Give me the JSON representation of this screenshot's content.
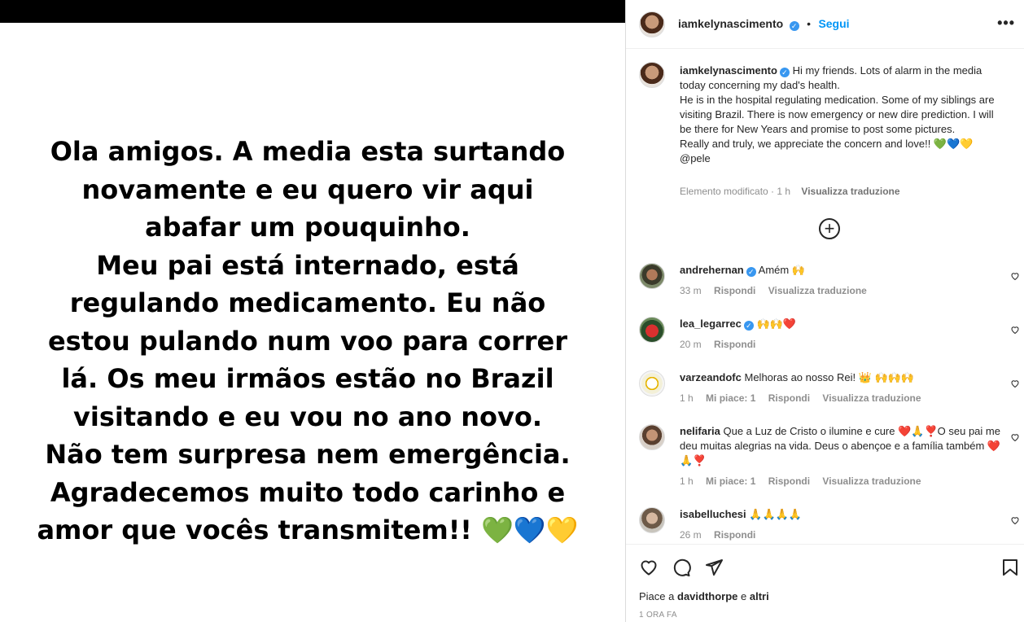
{
  "story": {
    "text": "Ola amigos. A media esta surtando\nnovamente e eu quero vir aqui\nabafar um pouquinho.\nMeu pai está internado, está\nregulando medicamento. Eu não\nestou pulando num voo para correr\nlá. Os meu irmãos estão no Brazil\nvisitando e eu vou no ano novo.\nNão tem surpresa nem emergência.\nAgradecemos muito todo carinho e\namor que vocês transmitem!! 💚💙💛"
  },
  "header": {
    "username": "iamkelynascimento",
    "dot": "•",
    "follow_label": "Segui",
    "more_label": "•••"
  },
  "caption": {
    "username": "iamkelynascimento",
    "text": "Hi my friends. Lots of alarm in the media today concerning my dad's health.\nHe is in the hospital regulating medication. Some of my siblings are visiting Brazil. There is now emergency or new dire prediction. I will be there for New Years and promise to post some pictures.\nReally and truly, we appreciate the concern and love!! 💚💙💛\n@pele",
    "edited": "Elemento modificato · 1 h",
    "translate": "Visualizza traduzione"
  },
  "comments": [
    {
      "username": "andrehernan",
      "verified": true,
      "text": "Amém 🙌",
      "time": "33 m",
      "likes": "",
      "reply": "Rispondi",
      "translate": "Visualizza traduzione"
    },
    {
      "username": "lea_legarrec",
      "verified": true,
      "text": "🙌🙌❤️",
      "time": "20 m",
      "likes": "",
      "reply": "Rispondi",
      "translate": ""
    },
    {
      "username": "varzeandofc",
      "verified": false,
      "text": "Melhoras ao nosso Rei! 👑 🙌🙌🙌",
      "time": "1 h",
      "likes": "Mi piace: 1",
      "reply": "Rispondi",
      "translate": "Visualizza traduzione"
    },
    {
      "username": "nelifaria",
      "verified": false,
      "text": "Que a Luz de Cristo o ilumine e cure ❤️🙏❣️O seu pai me deu muitas alegrias na vida. Deus o abençoe e a família também ❤️🙏❣️",
      "time": "1 h",
      "likes": "Mi piace: 1",
      "reply": "Rispondi",
      "translate": "Visualizza traduzione"
    },
    {
      "username": "isabelluchesi",
      "verified": false,
      "text": "🙏🙏🙏🙏",
      "time": "26 m",
      "likes": "",
      "reply": "Rispondi",
      "translate": ""
    }
  ],
  "footer": {
    "likes_prefix": "Piace a",
    "likes_user": "davidthorpe",
    "likes_and": "e",
    "likes_others": "altri",
    "time_ago": "1 ORA FA"
  }
}
